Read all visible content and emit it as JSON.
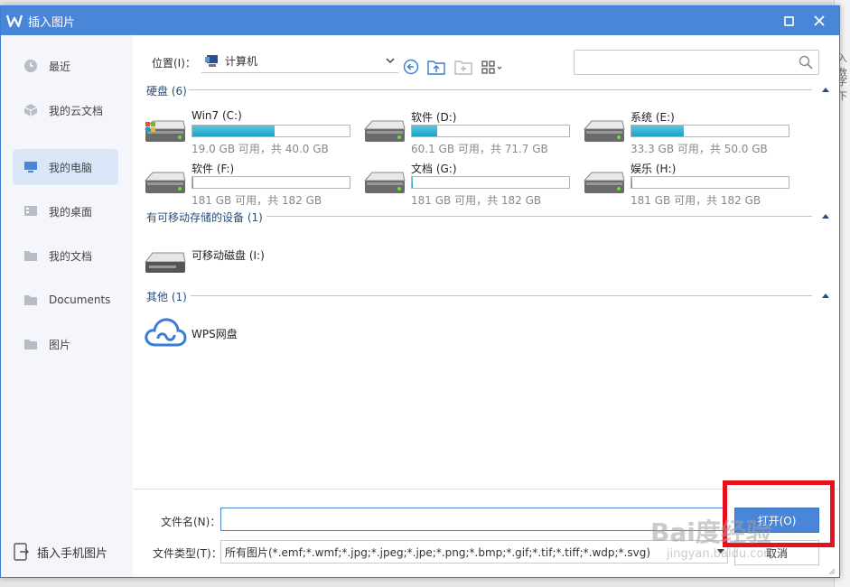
{
  "window": {
    "title": "插入图片"
  },
  "sidebar": {
    "items": [
      {
        "label": "最近",
        "icon": "clock-icon",
        "active": false
      },
      {
        "label": "我的云文档",
        "icon": "cloud-doc-icon",
        "active": false
      },
      {
        "label": "我的电脑",
        "icon": "computer-icon",
        "active": true
      },
      {
        "label": "我的桌面",
        "icon": "desktop-icon",
        "active": false
      },
      {
        "label": "我的文档",
        "icon": "folder-icon",
        "active": false
      },
      {
        "label": "Documents",
        "icon": "folder-icon",
        "active": false
      },
      {
        "label": "图片",
        "icon": "folder-icon",
        "active": false
      }
    ],
    "phone_label": "插入手机图片"
  },
  "toolbar": {
    "location_label": "位置(I)：",
    "location_value": "计算机",
    "search_placeholder": ""
  },
  "groups": {
    "disks": {
      "title": "硬盘 (6)"
    },
    "removable": {
      "title": "有可移动存储的设备 (1)"
    },
    "other": {
      "title": "其他 (1)"
    }
  },
  "drives": [
    {
      "name": "Win7 (C:)",
      "info": "19.0 GB 可用，共 40.0 GB",
      "used_fraction": 0.525
    },
    {
      "name": "软件 (D:)",
      "info": "60.1 GB 可用，共 71.7 GB",
      "used_fraction": 0.162
    },
    {
      "name": "系统 (E:)",
      "info": "33.3 GB 可用，共 50.0 GB",
      "used_fraction": 0.334
    },
    {
      "name": "软件 (F:)",
      "info": "181 GB 可用，共 182 GB",
      "used_fraction": 0.005
    },
    {
      "name": "文档 (G:)",
      "info": "181 GB 可用，共 182 GB",
      "used_fraction": 0.005
    },
    {
      "name": "娱乐 (H:)",
      "info": "181 GB 可用，共 182 GB",
      "used_fraction": 0.005
    }
  ],
  "removable": {
    "name": "可移动磁盘 (I:)"
  },
  "other": {
    "name": "WPS网盘"
  },
  "footer": {
    "filename_label": "文件名(N)：",
    "filename_value": "",
    "filetype_label": "文件类型(T)：",
    "filetype_value": "所有图片(*.emf;*.wmf;*.jpg;*.jpeg;*.jpe;*.png;*.bmp;*.gif;*.tif;*.tiff;*.wdp;*.svg)",
    "open_label": "打开(O)",
    "cancel_label": "取消"
  },
  "background": {
    "right_text_1": "入数",
    "right_text_2": "字下"
  },
  "watermark": {
    "brand": "Bai度经验",
    "url": "jingyan.baidu.com"
  },
  "colors": {
    "accent": "#4a86d8",
    "active_bg": "#d8e6f8",
    "highlight": "#e8101c",
    "drive_bar": "#1ea0c6"
  }
}
